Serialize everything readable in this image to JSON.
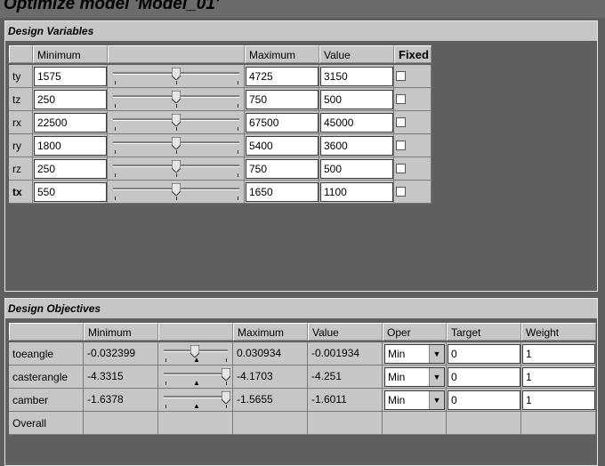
{
  "window": {
    "title": "Optimize model 'Model_01'"
  },
  "design_variables": {
    "title": "Design Variables",
    "columns": [
      "Minimum",
      "",
      "Maximum",
      "Value",
      "Fixed"
    ],
    "rows": [
      {
        "name": "ty",
        "min": "1575",
        "max": "4725",
        "value": "3150",
        "fixed": false,
        "level": 0.5
      },
      {
        "name": "tz",
        "min": "250",
        "max": "750",
        "value": "500",
        "fixed": false,
        "level": 0.5
      },
      {
        "name": "rx",
        "min": "22500",
        "max": "67500",
        "value": "45000",
        "fixed": false,
        "level": 0.5
      },
      {
        "name": "ry",
        "min": "1800",
        "max": "5400",
        "value": "3600",
        "fixed": false,
        "level": 0.5
      },
      {
        "name": "rz",
        "min": "250",
        "max": "750",
        "value": "500",
        "fixed": false,
        "level": 0.5
      },
      {
        "name": "tx",
        "min": "550",
        "max": "1650",
        "value": "1100",
        "fixed": false,
        "level": 0.5
      }
    ]
  },
  "design_objectives": {
    "title": "Design Objectives",
    "columns": [
      "Minimum",
      "",
      "Maximum",
      "Value",
      "Oper",
      "Target",
      "Weight"
    ],
    "rows": [
      {
        "name": "toeangle",
        "min": "-0.032399",
        "max": "0.030934",
        "value": "-0.001934",
        "oper": "Min",
        "target": "0",
        "weight": "1",
        "level": 0.48
      },
      {
        "name": "casterangle",
        "min": "-4.3315",
        "max": "-4.1703",
        "value": "-4.251",
        "oper": "Min",
        "target": "0",
        "weight": "1",
        "level": 1.0
      },
      {
        "name": "camber",
        "min": "-1.6378",
        "max": "-1.5655",
        "value": "-1.6011",
        "oper": "Min",
        "target": "0",
        "weight": "1",
        "level": 1.0
      }
    ],
    "overall_label": "Overall"
  }
}
